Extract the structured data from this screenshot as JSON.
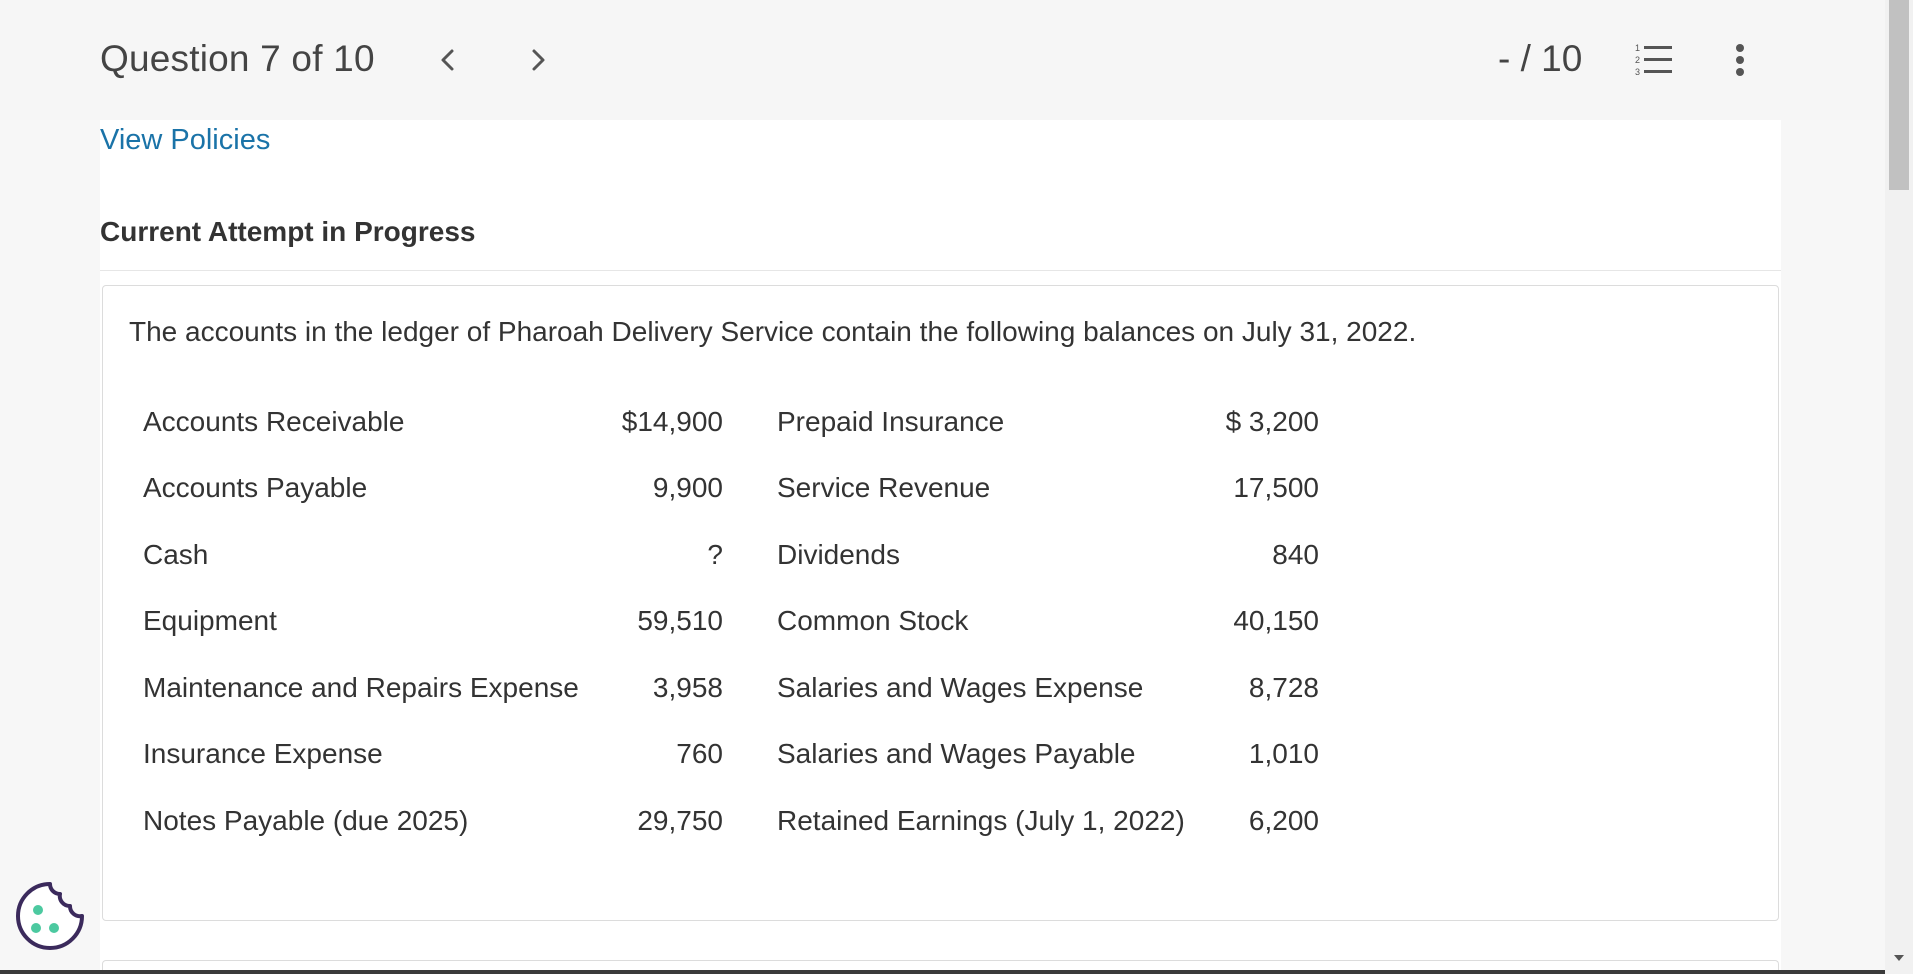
{
  "header": {
    "question_title": "Question 7 of 10",
    "score": "- / 10",
    "icons": [
      "chevron-left-icon",
      "chevron-right-icon",
      "numbered-list-icon",
      "more-vertical-icon"
    ]
  },
  "links": {
    "view_policies": "View Policies"
  },
  "status": {
    "attempt": "Current Attempt in Progress"
  },
  "problem": {
    "intro": "The accounts in the ledger of Pharoah Delivery Service contain the following balances on July 31, 2022.",
    "rows": [
      {
        "left_label": "Accounts Receivable",
        "left_value": "$14,900",
        "right_label": "Prepaid Insurance",
        "right_value": "$ 3,200"
      },
      {
        "left_label": "Accounts Payable",
        "left_value": "9,900",
        "right_label": "Service Revenue",
        "right_value": "17,500"
      },
      {
        "left_label": "Cash",
        "left_value": "?",
        "right_label": "Dividends",
        "right_value": "840"
      },
      {
        "left_label": "Equipment",
        "left_value": "59,510",
        "right_label": "Common Stock",
        "right_value": "40,150"
      },
      {
        "left_label": "Maintenance and Repairs Expense",
        "left_value": "3,958",
        "right_label": "Salaries and Wages Expense",
        "right_value": "8,728"
      },
      {
        "left_label": "Insurance Expense",
        "left_value": "760",
        "right_label": "Salaries and Wages Payable",
        "right_value": "1,010"
      },
      {
        "left_label": "Notes Payable (due 2025)",
        "left_value": "29,750",
        "right_label": "Retained Earnings (July 1, 2022)",
        "right_value": "6,200"
      }
    ]
  },
  "colors": {
    "link": "#1a73a8",
    "cookie_outline": "#3b2a5c",
    "cookie_dots": "#4cc9a0"
  },
  "cookie_button": {
    "icon": "cookie-icon"
  }
}
